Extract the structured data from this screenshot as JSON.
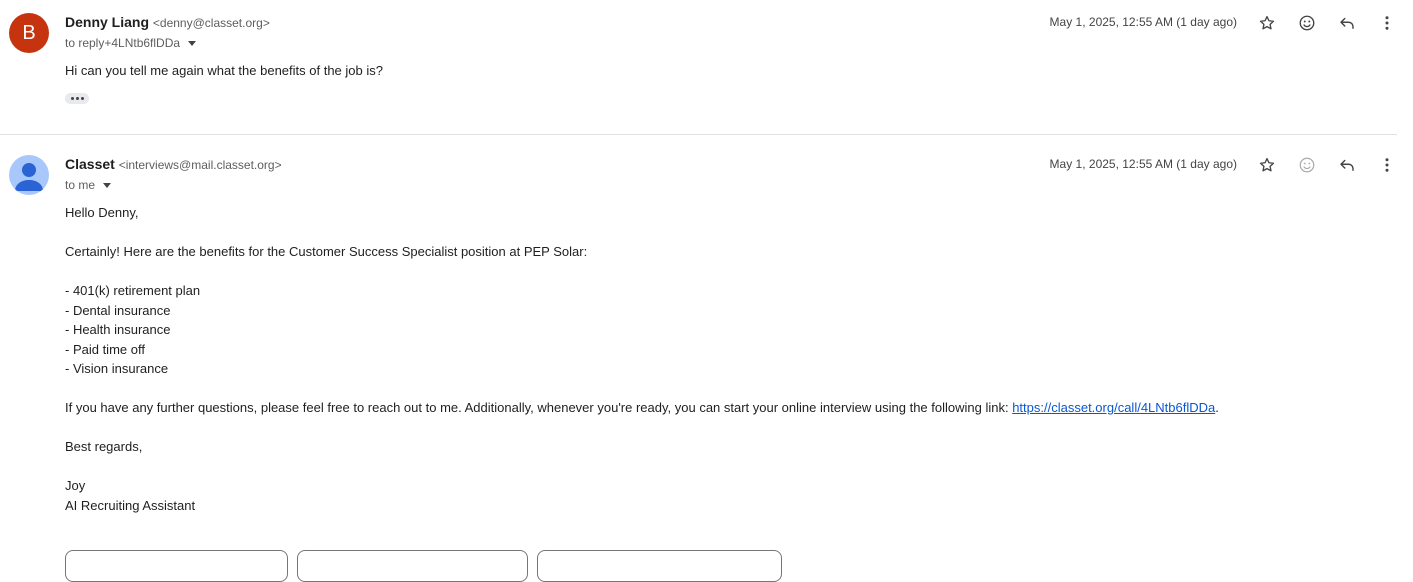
{
  "messages": [
    {
      "avatar_letter": "B",
      "avatar_color": "#c5330f",
      "sender_name": "Denny Liang",
      "sender_email": "<denny@classet.org>",
      "recipients": "to reply+4LNtb6flDDa",
      "date": "May 1, 2025, 12:55 AM (1 day ago)",
      "body": [
        "Hi can you tell me again what the benefits of the job is?"
      ]
    },
    {
      "avatar_icon": "person-icon",
      "sender_name": "Classet",
      "sender_email": "<interviews@mail.classet.org>",
      "recipients": "to me",
      "date": "May 1, 2025, 12:55 AM (1 day ago)",
      "greeting": "Hello Denny,",
      "intro": "Certainly! Here are the benefits for the Customer Success Specialist position at PEP Solar:",
      "benefits": [
        "- 401(k) retirement plan",
        "- Dental insurance",
        "- Health insurance",
        "- Paid time off",
        "- Vision insurance"
      ],
      "closing_text": "If you have any further questions, please feel free to reach out to me. Additionally, whenever you're ready, you can start your online interview using the following link: ",
      "link": "https://classet.org/call/4LNtb6flDDa",
      "link_suffix": ".",
      "signoff": "Best regards,",
      "signature_name": "Joy",
      "signature_title": "AI Recruiting Assistant"
    }
  ],
  "icons": [
    "star-icon",
    "emoji-icon",
    "reply-icon",
    "more-icon"
  ],
  "colors": {
    "link": "#0b57d0",
    "avatar_b": "#c5330f",
    "avatar_generic": "#a8c7fa"
  }
}
